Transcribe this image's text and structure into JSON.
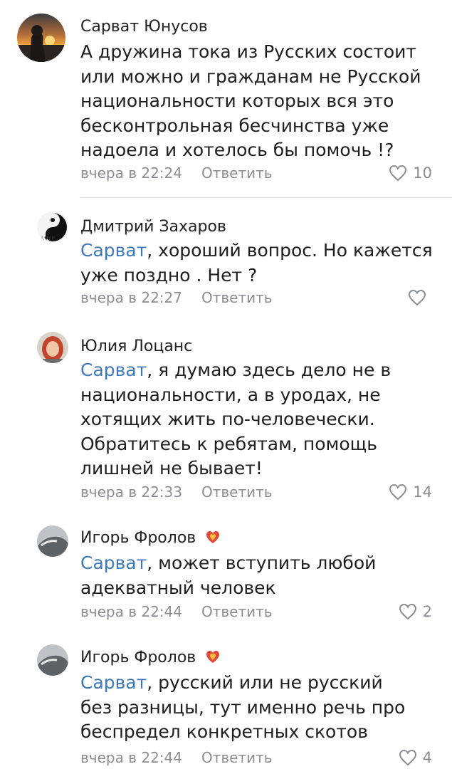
{
  "colors": {
    "mention": "#3d78b8",
    "meta": "#8a8d92",
    "text": "#1e1e1e",
    "badge": "#e0493a"
  },
  "comments": [
    {
      "author": "Сарват Юнусов",
      "mention": "",
      "lines": [
        "А дружина тока из Русских состоит",
        "или можно и гражданам не Русской",
        "национальности которых вся это",
        "бесконтрольная бесчинства уже",
        "надоела и хотелось бы помочь !?"
      ],
      "time": "вчера в 22:24",
      "reply": "Ответить",
      "likes": "10",
      "avatar_icon": "sunset-photo-avatar"
    },
    {
      "author": "Дмитрий Захаров",
      "mention": "Сарват",
      "lines": [
        ", хороший вопрос. Но кажется",
        "уже поздно . Нет ?"
      ],
      "time": "вчера в 22:27",
      "reply": "Ответить",
      "likes": "",
      "avatar_icon": "yin-yang-avatar"
    },
    {
      "author": "Юлия Лоцанс",
      "mention": "Сарват",
      "lines": [
        ", я думаю здесь дело не в",
        "национальности, а в уродах, не",
        "хотящих жить по-человечески.",
        "Обратитесь к ребятам, помощь",
        "лишней не бывает!"
      ],
      "time": "вчера в 22:33",
      "reply": "Ответить",
      "likes": "14",
      "avatar_icon": "redhead-photo-avatar"
    },
    {
      "author": "Игорь Фролов",
      "mention": "Сарват",
      "lines": [
        ", может вступить любой",
        "адекватный человек"
      ],
      "time": "вчера в 22:44",
      "reply": "Ответить",
      "likes": "2",
      "avatar_icon": "car-photo-avatar",
      "badge_icon": "flaming-heart-icon"
    },
    {
      "author": "Игорь Фролов",
      "mention": "Сарват",
      "lines": [
        ", русский или не русский",
        "без разницы, тут именно речь про",
        "беспредел конкретных скотов"
      ],
      "time": "вчера в 22:44",
      "reply": "Ответить",
      "likes": "4",
      "avatar_icon": "car-photo-avatar",
      "badge_icon": "flaming-heart-icon"
    }
  ]
}
